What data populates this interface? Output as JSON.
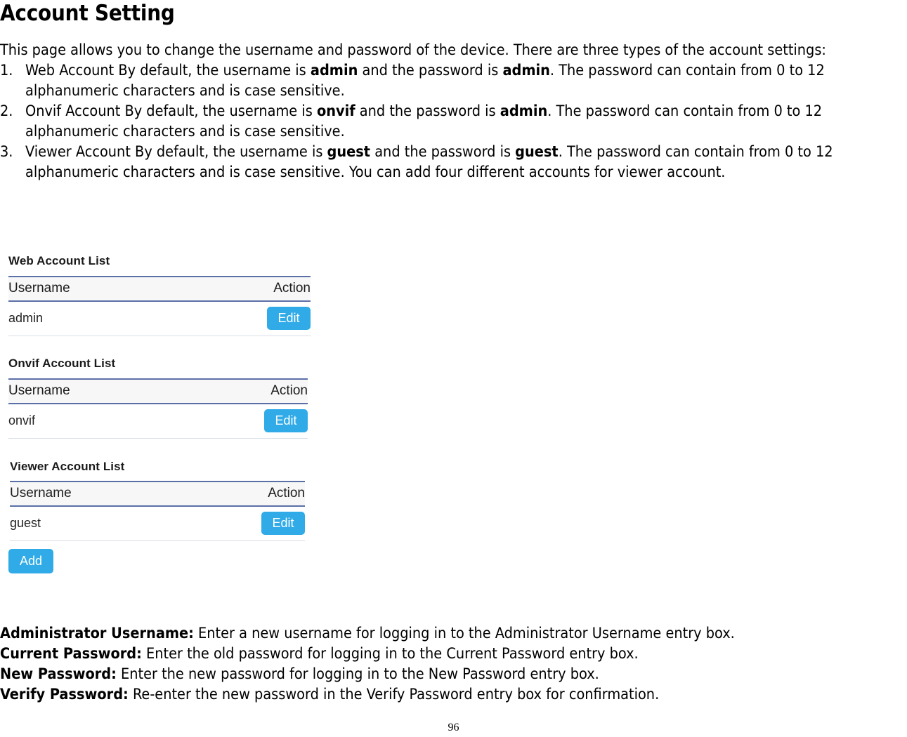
{
  "document": {
    "title": "Account Setting",
    "intro": "This page allows you to change the username and password of the device. There are three types of the account settings:",
    "page_number": "96"
  },
  "account_types": [
    {
      "number": "1.",
      "line1_pre": "Web Account By default, the username is ",
      "line1_bold1": "admin",
      "line1_mid": " and the password is ",
      "line1_bold2": "admin",
      "line1_post": ". The password can contain from 0 to 12",
      "line2": "alphanumeric characters and is case sensitive."
    },
    {
      "number": "2.",
      "line1_pre": "Onvif Account By default, the username is ",
      "line1_bold1": "onvif",
      "line1_mid": " and the password is ",
      "line1_bold2": "admin",
      "line1_post": ". The password can contain from 0 to 12",
      "line2": "alphanumeric characters and is case sensitive."
    },
    {
      "number": "3.",
      "line1_pre": "Viewer Account By default, the username is ",
      "line1_bold1": "guest",
      "line1_mid": " and the password is ",
      "line1_bold2": "guest",
      "line1_post": ". The password can contain from 0 to 12",
      "line2": "alphanumeric characters and is case sensitive. You can add four different accounts for viewer account."
    }
  ],
  "ui": {
    "accent_color": "#30abe8",
    "header_border_color": "#5b6fa8",
    "header_bg_color": "#f7f7f7",
    "row_border_color": "#d8dde6",
    "web_account": {
      "title": "Web Account List",
      "columns": [
        "Username",
        "Action"
      ],
      "rows": [
        {
          "username": "admin",
          "action_label": "Edit"
        }
      ]
    },
    "onvif_account": {
      "title": "Onvif Account List",
      "columns": [
        "Username",
        "Action"
      ],
      "rows": [
        {
          "username": "onvif",
          "action_label": "Edit"
        }
      ]
    },
    "viewer_account": {
      "title": "Viewer Account List",
      "columns": [
        "Username",
        "Action"
      ],
      "rows": [
        {
          "username": "guest",
          "action_label": "Edit"
        }
      ],
      "add_label": "Add"
    }
  },
  "definitions": [
    {
      "term": "Administrator Username:",
      "description": " Enter a new username for logging in to the Administrator Username entry box."
    },
    {
      "term": "Current Password:",
      "description": " Enter the old password for logging in to the Current Password entry box."
    },
    {
      "term": "New Password:",
      "description": " Enter the new password for logging in to the New Password entry box."
    },
    {
      "term": "Verify Password:",
      "description": " Re-enter the new password in the Verify Password entry box for confirmation."
    }
  ]
}
